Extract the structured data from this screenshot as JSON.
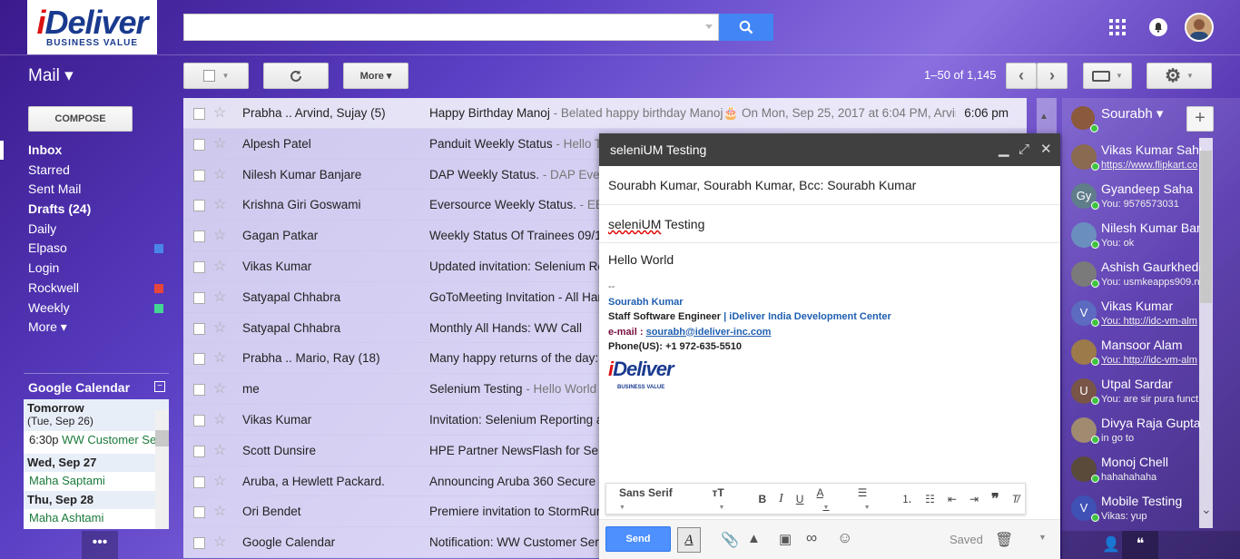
{
  "brand": {
    "logo_text": "iDeliver",
    "logo_sub": "BUSINESS VALUE"
  },
  "header": {
    "search_placeholder": ""
  },
  "toolbar": {
    "mail_label": "Mail ▾",
    "more_label": "More ▾",
    "pager": "1–50 of 1,145"
  },
  "sidebar": {
    "compose_label": "COMPOSE",
    "items": [
      {
        "label": "Inbox",
        "bold": true
      },
      {
        "label": "Starred"
      },
      {
        "label": "Sent Mail"
      },
      {
        "label": "Drafts (24)",
        "bold": true
      },
      {
        "label": "Daily"
      },
      {
        "label": "Elpaso",
        "color": "#4a86e8"
      },
      {
        "label": "Login"
      },
      {
        "label": "Rockwell",
        "color": "#e8453c"
      },
      {
        "label": "Weekly",
        "color": "#43d692"
      },
      {
        "label": "More ▾"
      }
    ]
  },
  "calendar": {
    "title": "Google Calendar",
    "days": [
      {
        "day": "Tomorrow",
        "date": "(Tue, Sep 26)",
        "events": [
          {
            "time": "6:30p",
            "title": "WW Customer Se"
          }
        ]
      },
      {
        "day": "Wed, Sep 27",
        "events": [
          {
            "title": "Maha Saptami"
          }
        ]
      },
      {
        "day": "Thu, Sep 28",
        "events": [
          {
            "title": "Maha Ashtami"
          }
        ]
      }
    ]
  },
  "emails": [
    {
      "from": "Prabha .. Arvind, Sujay (5)",
      "subject": "Happy Birthday Manoj",
      "snippet": " - Belated happy birthday Manoj🎂 On Mon, Sep 25, 2017 at 6:04 PM, Arvir",
      "time": "6:06 pm"
    },
    {
      "from": "Alpesh Patel",
      "subject": "Panduit Weekly Status",
      "snippet": " - Hello Te",
      "time": ""
    },
    {
      "from": "Nilesh Kumar Banjare",
      "subject": "DAP Weekly Status.",
      "snippet": " - DAP Evers",
      "time": ""
    },
    {
      "from": "Krishna Giri Goswami",
      "subject": "Eversource Weekly Status.",
      "snippet": " - EB",
      "time": ""
    },
    {
      "from": "Gagan Patkar",
      "subject": "Weekly Status Of Trainees 09/18",
      "snippet": "",
      "time": ""
    },
    {
      "from": "Vikas Kumar",
      "subject": "Updated invitation: Selenium Rep",
      "snippet": "",
      "time": ""
    },
    {
      "from": "Satyapal Chhabra",
      "subject": "GoToMeeting Invitation - All Han",
      "snippet": "",
      "time": ""
    },
    {
      "from": "Satyapal Chhabra",
      "subject": "Monthly All Hands: WW Call",
      "snippet": "",
      "time": ""
    },
    {
      "from": "Prabha .. Mario, Ray (18)",
      "subject": "Many happy returns of the day: M",
      "snippet": "",
      "time": ""
    },
    {
      "from": "me",
      "subject": "Selenium Testing",
      "snippet": " - Hello World",
      "time": ""
    },
    {
      "from": "Vikas Kumar",
      "subject": "Invitation: Selenium Reporting ar",
      "snippet": "",
      "time": ""
    },
    {
      "from": "Scott Dunsire",
      "subject": "HPE Partner NewsFlash for Sept",
      "snippet": "",
      "time": ""
    },
    {
      "from": "Aruba, a Hewlett Packard.",
      "subject": "Announcing Aruba 360 Secure F",
      "snippet": "",
      "time": ""
    },
    {
      "from": "Ori Bendet",
      "subject": "Premiere invitation to StormRunn",
      "snippet": "",
      "time": ""
    },
    {
      "from": "Google Calendar",
      "subject": "Notification: WW Customer Servi",
      "snippet": "",
      "time": ""
    }
  ],
  "compose": {
    "title": "seleniUM Testing",
    "to": "Sourabh Kumar, Sourabh Kumar, Bcc: Sourabh Kumar",
    "subject_word": "seleniUM",
    "subject_rest": " Testing",
    "body": "Hello World",
    "sig_dash": "--",
    "sig_name": "Sourabh Kumar",
    "sig_role": "Staff Software Engineer",
    "sig_org": "iDeliver India Development Center",
    "sig_email_label": "e-mail :",
    "sig_email": "sourabh@ideliver-inc.com",
    "sig_phone": "Phone(US):   +1 972-635-5510",
    "font_label": "Sans Serif",
    "send_label": "Send",
    "saved_label": "Saved"
  },
  "chat": {
    "me": "Sourabh ▾",
    "contacts": [
      {
        "name": "Vikas Kumar Sahu",
        "status": "https://www.flipkart.co",
        "link": true,
        "initial": "",
        "color": "#8a6a50"
      },
      {
        "name": "Gyandeep Saha",
        "status": "You: 9576573031",
        "initial": "Gy",
        "color": "#607d8b"
      },
      {
        "name": "Nilesh Kumar Ban",
        "status": "You: ok",
        "initial": "",
        "color": "#6a8fbf"
      },
      {
        "name": "Ashish Gaurkhede",
        "status": "You: usmkeapps909.n",
        "initial": "",
        "color": "#7a7a7a"
      },
      {
        "name": "Vikas Kumar",
        "status": "You: http://idc-vm-alm",
        "link": true,
        "initial": "V",
        "color": "#5c6bc0"
      },
      {
        "name": "Mansoor Alam",
        "status": "You: http://idc-vm-alm",
        "link": true,
        "initial": "",
        "color": "#9c7a4a"
      },
      {
        "name": "Utpal Sardar",
        "status": "You: are sir pura funct",
        "initial": "U",
        "color": "#795548"
      },
      {
        "name": "Divya Raja Gupta",
        "status": "in go to",
        "initial": "",
        "color": "#a08a70"
      },
      {
        "name": "Monoj Chell",
        "status": "hahahahaha",
        "initial": "",
        "color": "#5a4a3a"
      },
      {
        "name": "Mobile Testing",
        "status": "Vikas: yup",
        "initial": "V",
        "color": "#3f51b5"
      }
    ]
  }
}
